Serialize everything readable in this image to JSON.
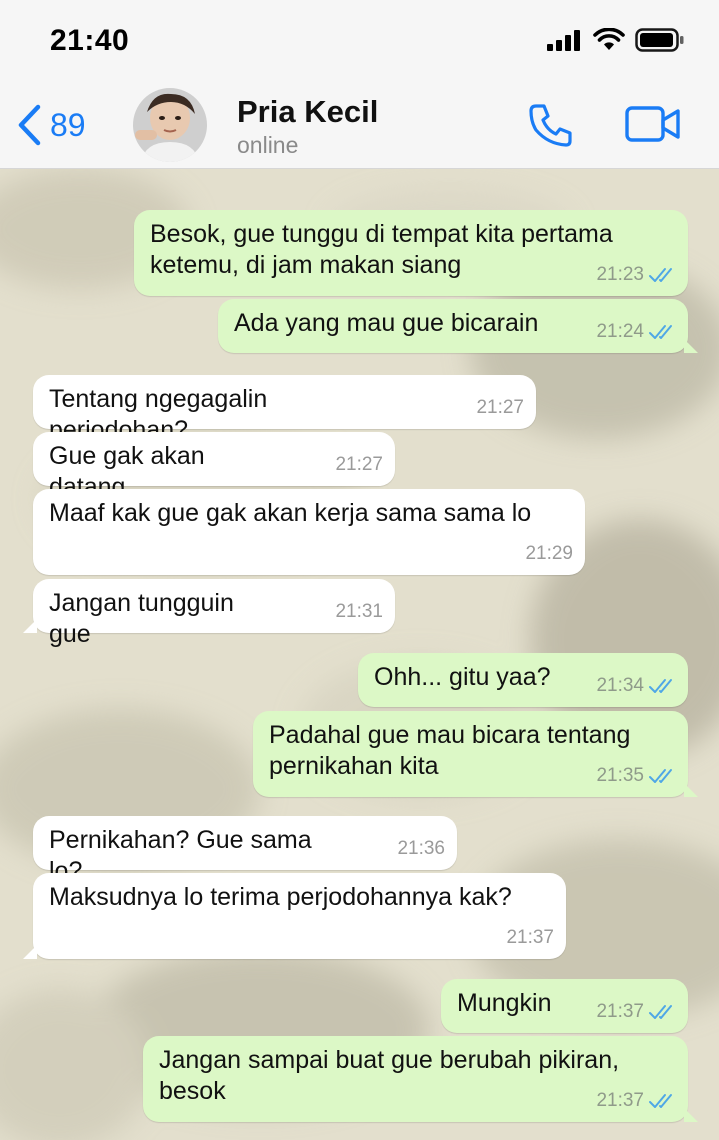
{
  "status_bar": {
    "time": "21:40"
  },
  "header": {
    "back_count": "89",
    "contact_name": "Pria Kecil",
    "contact_status": "online"
  },
  "messages": [
    {
      "dir": "out",
      "text": "Besok, gue tunggu di tempat kita pertama ketemu, di jam makan siang",
      "time": "21:23",
      "read": true
    },
    {
      "dir": "out",
      "text": "Ada yang mau gue bicarain",
      "time": "21:24",
      "read": true
    },
    {
      "dir": "in",
      "text": "Tentang ngegagalin perjodohan?",
      "time": "21:27"
    },
    {
      "dir": "in",
      "text": "Gue gak akan datang",
      "time": "21:27"
    },
    {
      "dir": "in",
      "text": "Maaf kak gue gak akan kerja sama sama lo",
      "time": "21:29"
    },
    {
      "dir": "in",
      "text": "Jangan tungguin gue",
      "time": "21:31"
    },
    {
      "dir": "out",
      "text": "Ohh... gitu yaa?",
      "time": "21:34",
      "read": true
    },
    {
      "dir": "out",
      "text": "Padahal gue mau bicara tentang pernikahan kita",
      "time": "21:35",
      "read": true
    },
    {
      "dir": "in",
      "text": "Pernikahan? Gue sama lo?",
      "time": "21:36"
    },
    {
      "dir": "in",
      "text": "Maksudnya lo terima perjodohannya kak?",
      "time": "21:37"
    },
    {
      "dir": "out",
      "text": "Mungkin",
      "time": "21:37",
      "read": true
    },
    {
      "dir": "out",
      "text": "Jangan sampai buat gue berubah pikiran, besok",
      "time": "21:37",
      "read": true
    }
  ],
  "colors": {
    "accent": "#1a7cf5",
    "outgoing_bubble": "#dcf8c6",
    "incoming_bubble": "#ffffff",
    "read_ticks": "#4fa7e6"
  }
}
